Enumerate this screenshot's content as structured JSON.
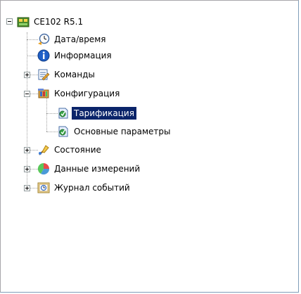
{
  "tree": {
    "root": {
      "label": "CE102 R5.1",
      "icon": "device-icon",
      "expanded": true
    },
    "items": [
      {
        "label": "Дата/время",
        "icon": "clock-icon"
      },
      {
        "label": "Информация",
        "icon": "info-icon"
      },
      {
        "label": "Команды",
        "icon": "commands-icon",
        "expanded": false
      },
      {
        "label": "Конфигурация",
        "icon": "config-icon",
        "expanded": true,
        "children": [
          {
            "label": "Тарификация",
            "icon": "settings-leaf-icon",
            "selected": true
          },
          {
            "label": "Основные параметры",
            "icon": "settings-leaf-icon"
          }
        ]
      },
      {
        "label": "Состояние",
        "icon": "state-icon",
        "expanded": false
      },
      {
        "label": "Данные измерений",
        "icon": "measurements-icon",
        "expanded": false
      },
      {
        "label": "Журнал событий",
        "icon": "event-log-icon",
        "expanded": false
      }
    ]
  },
  "colors": {
    "selection": "#0a246a",
    "border": "#7f9db9"
  }
}
